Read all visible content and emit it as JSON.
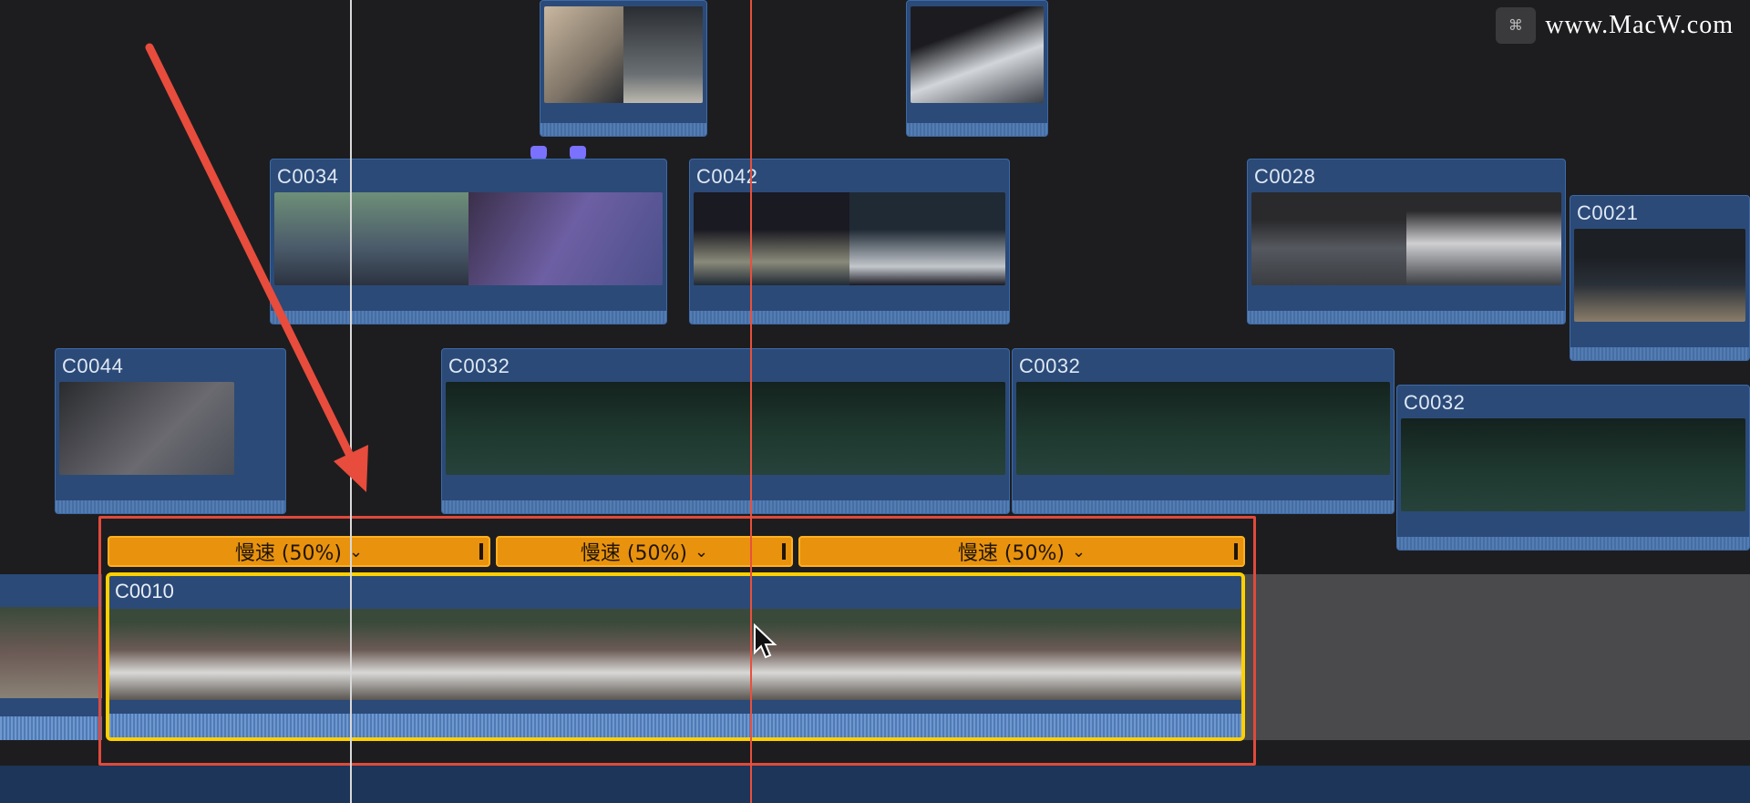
{
  "watermark": {
    "text": "www.MacW.com",
    "logo_icon": "macw-logo-icon"
  },
  "clips": [
    {
      "id": "top-clip-1",
      "label": "",
      "palette": [
        "#c9b7a0",
        "#2a2e33",
        "#6a6f73"
      ]
    },
    {
      "id": "top-clip-2",
      "label": "",
      "palette": [
        "#1c1c20",
        "#d2d6da",
        "#3d4148"
      ]
    },
    {
      "id": "clip-c0034",
      "label": "C0034",
      "palette": [
        "#6e8f78",
        "#4a5a6a",
        "#3b2f4a",
        "#6d5fa3"
      ]
    },
    {
      "id": "clip-c0042",
      "label": "C0042",
      "palette": [
        "#1a1a22",
        "#8a8a7a",
        "#202a35",
        "#c2c7cc"
      ]
    },
    {
      "id": "clip-c0028",
      "label": "C0028",
      "palette": [
        "#2a2a2c",
        "#cfcfd2",
        "#3a3d42"
      ]
    },
    {
      "id": "clip-c0021",
      "label": "C0021",
      "palette": [
        "#1c1f24",
        "#2a3038",
        "#8a7d6a"
      ]
    },
    {
      "id": "clip-c0044",
      "label": "C0044",
      "palette": [
        "#2a2b2f",
        "#6a6a70",
        "#4a4e58"
      ]
    },
    {
      "id": "clip-c0032-a",
      "label": "C0032",
      "palette": [
        "#14221e",
        "#1f3a30",
        "#26423a"
      ]
    },
    {
      "id": "clip-c0032-b",
      "label": "C0032",
      "palette": [
        "#14221e",
        "#1f3a30",
        "#26423a"
      ]
    },
    {
      "id": "clip-c0032-c",
      "label": "C0032",
      "palette": [
        "#14221e",
        "#1f3a30",
        "#26423a"
      ]
    }
  ],
  "primary_clip": {
    "label": "C0010",
    "speed_segments": [
      {
        "label": "慢速 (50%)",
        "chevron": "⌄"
      },
      {
        "label": "慢速 (50%)",
        "chevron": "⌄"
      },
      {
        "label": "慢速 (50%)",
        "chevron": "⌄"
      }
    ]
  },
  "colors": {
    "clip_blue": "#2b4a78",
    "speed_orange": "#e8920e",
    "selection_yellow": "#ffd000",
    "annotation_red": "#e04a3c",
    "playhead_red": "#e8513d",
    "marker_purple": "#7a72ff"
  }
}
